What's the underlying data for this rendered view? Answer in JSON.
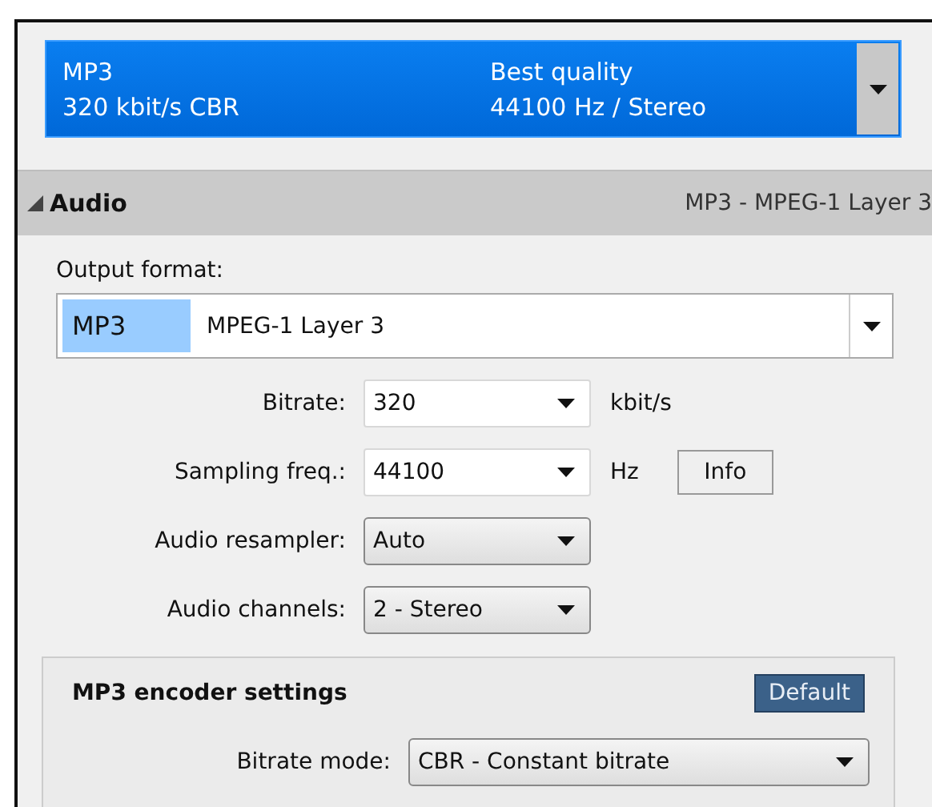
{
  "preset": {
    "format": "MP3",
    "bitrate": "320 kbit/s CBR",
    "quality": "Best quality",
    "details": "44100 Hz / Stereo"
  },
  "section": {
    "title": "Audio",
    "expanded": true,
    "summary": "MP3 - MPEG-1 Layer 3"
  },
  "output_format": {
    "label": "Output format:",
    "code": "MP3",
    "name": "MPEG-1 Layer 3"
  },
  "fields": [
    {
      "label": "Bitrate:",
      "kind": "editable",
      "value": "320",
      "unit": "kbit/s"
    },
    {
      "label": "Sampling freq.:",
      "kind": "editable",
      "value": "44100",
      "unit": "Hz",
      "button": "Info"
    },
    {
      "label": "Audio resampler:",
      "kind": "select",
      "value": "Auto"
    },
    {
      "label": "Audio channels:",
      "kind": "select",
      "value": "2 - Stereo"
    }
  ],
  "encoder": {
    "title": "MP3 encoder settings",
    "button": "Default",
    "fields": [
      {
        "label": "Bitrate mode:",
        "kind": "select",
        "value": "CBR - Constant bitrate"
      }
    ]
  }
}
